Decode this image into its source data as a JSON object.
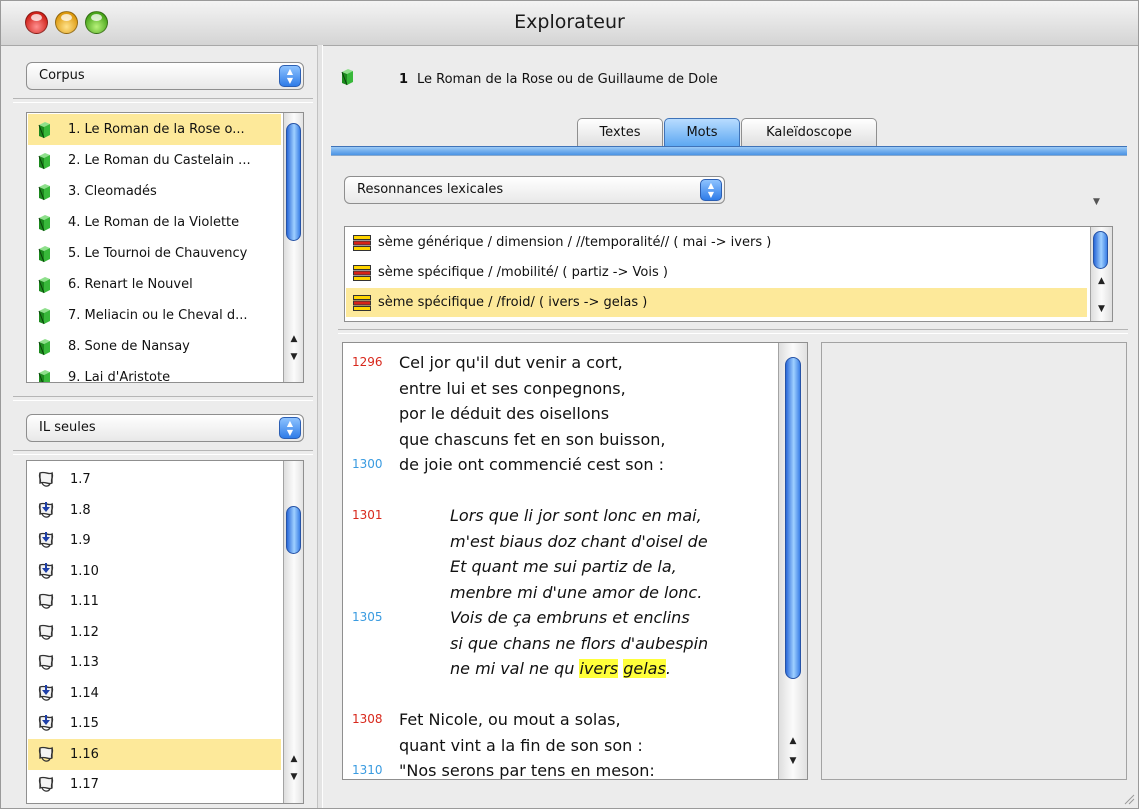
{
  "window": {
    "title": "Explorateur"
  },
  "left": {
    "corpus_popup": "Corpus",
    "corpus_items": [
      "1. Le Roman de la Rose o...",
      "2. Le Roman du Castelain ...",
      "3. Cleomadés",
      "4. Le Roman de la Violette",
      "5. Le Tournoi de Chauvency",
      "6. Renart le Nouvel",
      "7. Meliacin ou le Cheval d...",
      "8. Sone de Nansay",
      "9. Lai d'Aristote"
    ],
    "corpus_selected": 0,
    "il_popup": "IL seules",
    "il_items": [
      "1.7",
      "1.8",
      "1.9",
      "1.10",
      "1.11",
      "1.12",
      "1.13",
      "1.14",
      "1.15",
      "1.16",
      "1.17"
    ],
    "il_selected": 9
  },
  "header": {
    "number": "1",
    "title": "Le Roman de la Rose ou de Guillaume de Dole"
  },
  "tabs": [
    "Textes",
    "Mots",
    "Kaleïdoscope"
  ],
  "active_tab": "Mots",
  "mots": {
    "popup": "Resonnances lexicales",
    "semes": [
      "sème générique / dimension / //temporalité// ( mai -> ivers )",
      "sème spécifique / /mobilité/ ( partiz -> Vois )",
      "sème spécifique / /froid/ ( ivers -> gelas )"
    ],
    "seme_selected": 2
  },
  "verses": [
    {
      "num": "1296",
      "num_color": "#d8281c",
      "text": "Cel jor qu'il dut venir a cort,",
      "italic": false
    },
    {
      "num": "",
      "num_color": "",
      "text": "entre lui et ses conpegnons,",
      "italic": false
    },
    {
      "num": "",
      "num_color": "",
      "text": "por le déduit des oisellons",
      "italic": false
    },
    {
      "num": "",
      "num_color": "",
      "text": "que chascuns fet en son buisson,",
      "italic": false
    },
    {
      "num": "1300",
      "num_color": "#3a9be0",
      "text": "de joie ont commencié cest son :",
      "italic": false
    },
    {
      "num": "",
      "num_color": "",
      "text": "",
      "italic": false
    },
    {
      "num": "1301",
      "num_color": "#d8281c",
      "text": "Lors que li jor sont lonc en mai,",
      "italic": true
    },
    {
      "num": "",
      "num_color": "",
      "text": "m'est biaus doz chant d'oisel de",
      "italic": true
    },
    {
      "num": "",
      "num_color": "",
      "text": "Et quant me sui partiz de la,",
      "italic": true
    },
    {
      "num": "",
      "num_color": "",
      "text": "menbre mi d'une amor de lonc.",
      "italic": true
    },
    {
      "num": "1305",
      "num_color": "#3a9be0",
      "text": "Vois de ça embruns et enclins",
      "italic": true
    },
    {
      "num": "",
      "num_color": "",
      "text": "si que chans ne flors d'aubespin",
      "italic": true
    },
    {
      "num": "",
      "num_color": "",
      "text": "ne mi val ne qu",
      "italic": true,
      "hl": [
        "ivers",
        "gelas"
      ]
    },
    {
      "num": "",
      "num_color": "",
      "text": "",
      "italic": false
    },
    {
      "num": "1308",
      "num_color": "#d8281c",
      "text": "Fet Nicole, ou mout a solas,",
      "italic": false
    },
    {
      "num": "",
      "num_color": "",
      "text": "quant vint a la fin de son son :",
      "italic": false
    },
    {
      "num": "1310",
      "num_color": "#3a9be0",
      "text": "\"Nos serons par tens en meson:",
      "italic": false
    }
  ],
  "colors": {
    "highlight": "#ffff3a",
    "selection": "#fde99a",
    "aqua": "#5aa6f1"
  }
}
